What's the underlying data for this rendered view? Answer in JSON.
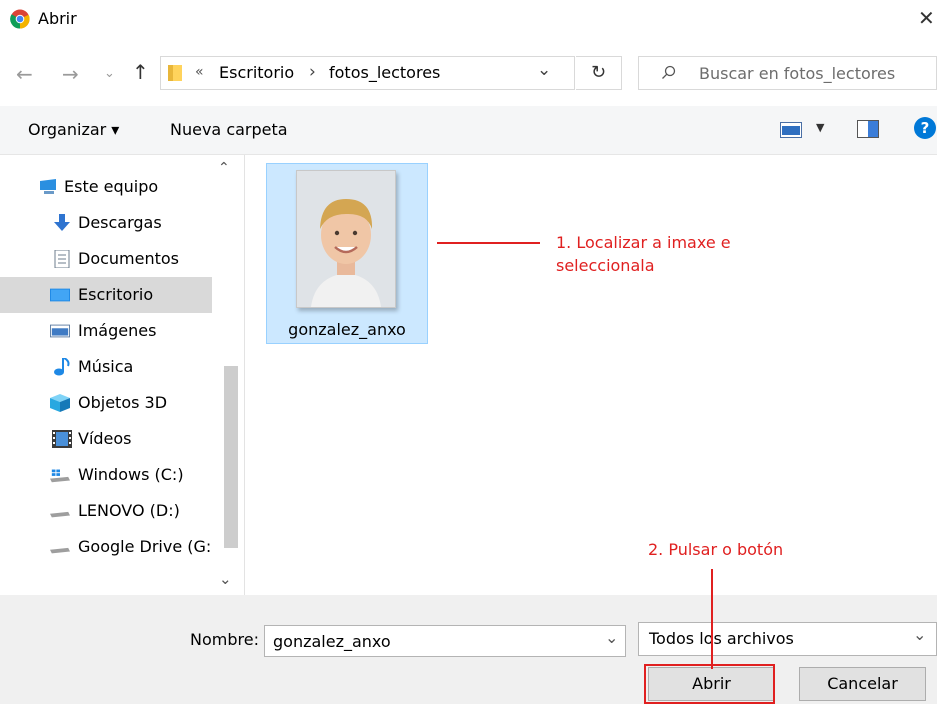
{
  "window": {
    "title": "Abrir"
  },
  "address": {
    "overflow": "«",
    "crumbs": [
      "Escritorio",
      "fotos_lectores"
    ],
    "separator": "›"
  },
  "search": {
    "placeholder": "Buscar en fotos_lectores"
  },
  "toolbar": {
    "organize_label": "Organizar ▾",
    "new_folder_label": "Nueva carpeta",
    "help_label": "?"
  },
  "sidebar": {
    "items": [
      {
        "label": "Este equipo",
        "icon": "computer-icon"
      },
      {
        "label": "Descargas",
        "icon": "download-icon"
      },
      {
        "label": "Documentos",
        "icon": "documents-icon"
      },
      {
        "label": "Escritorio",
        "icon": "desktop-icon"
      },
      {
        "label": "Imágenes",
        "icon": "pictures-icon"
      },
      {
        "label": "Música",
        "icon": "music-icon"
      },
      {
        "label": "Objetos 3D",
        "icon": "3d-objects-icon"
      },
      {
        "label": "Vídeos",
        "icon": "videos-icon"
      },
      {
        "label": "Windows (C:)",
        "icon": "windows-drive-icon"
      },
      {
        "label": "LENOVO (D:)",
        "icon": "drive-icon"
      },
      {
        "label": "Google Drive (G:)",
        "icon": "drive-icon"
      }
    ]
  },
  "files": [
    {
      "name": "gonzalez_anxo",
      "selected": true
    }
  ],
  "annotations": {
    "step1_line1": "1. Localizar a imaxe e",
    "step1_line2": "seleccionala",
    "step2": "2. Pulsar o botón"
  },
  "footer": {
    "name_label": "Nombre:",
    "name_value": "gonzalez_anxo",
    "filter_value": "Todos los archivos",
    "open_label": "Abrir",
    "cancel_label": "Cancelar"
  },
  "colors": {
    "annotation": "#e02020",
    "selection": "#cce8ff",
    "accent": "#0078d7"
  }
}
